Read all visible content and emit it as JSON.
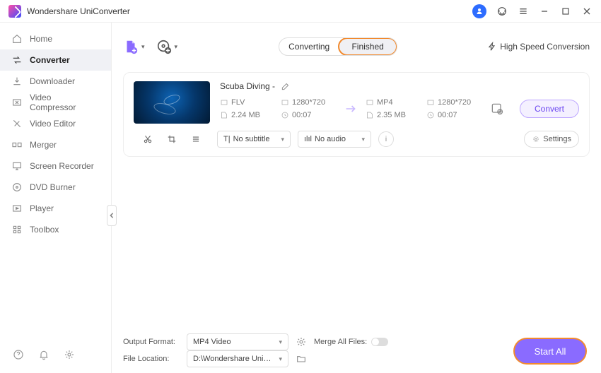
{
  "app": {
    "title": "Wondershare UniConverter"
  },
  "titlebar": {
    "avatar_name": "user-avatar"
  },
  "sidebar": {
    "items": [
      {
        "label": "Home",
        "icon": "home-icon"
      },
      {
        "label": "Converter",
        "icon": "converter-icon"
      },
      {
        "label": "Downloader",
        "icon": "downloader-icon"
      },
      {
        "label": "Video Compressor",
        "icon": "compressor-icon"
      },
      {
        "label": "Video Editor",
        "icon": "editor-icon"
      },
      {
        "label": "Merger",
        "icon": "merger-icon"
      },
      {
        "label": "Screen Recorder",
        "icon": "recorder-icon"
      },
      {
        "label": "DVD Burner",
        "icon": "dvd-icon"
      },
      {
        "label": "Player",
        "icon": "player-icon"
      },
      {
        "label": "Toolbox",
        "icon": "toolbox-icon"
      }
    ],
    "active_index": 1
  },
  "topbar": {
    "tabs": {
      "converting": "Converting",
      "finished": "Finished"
    },
    "active_tab": "finished",
    "high_speed": "High Speed Conversion"
  },
  "item": {
    "name": "Scuba Diving  -",
    "source": {
      "format": "FLV",
      "resolution": "1280*720",
      "size": "2.24 MB",
      "duration": "00:07"
    },
    "target": {
      "format": "MP4",
      "resolution": "1280*720",
      "size": "2.35 MB",
      "duration": "00:07"
    },
    "subtitle": "No subtitle",
    "audio": "No audio",
    "settings_label": "Settings",
    "convert_label": "Convert"
  },
  "bottom": {
    "output_format_label": "Output Format:",
    "output_format_value": "MP4 Video",
    "file_location_label": "File Location:",
    "file_location_value": "D:\\Wondershare UniConverter",
    "merge_label": "Merge All Files:",
    "start_all": "Start All"
  }
}
